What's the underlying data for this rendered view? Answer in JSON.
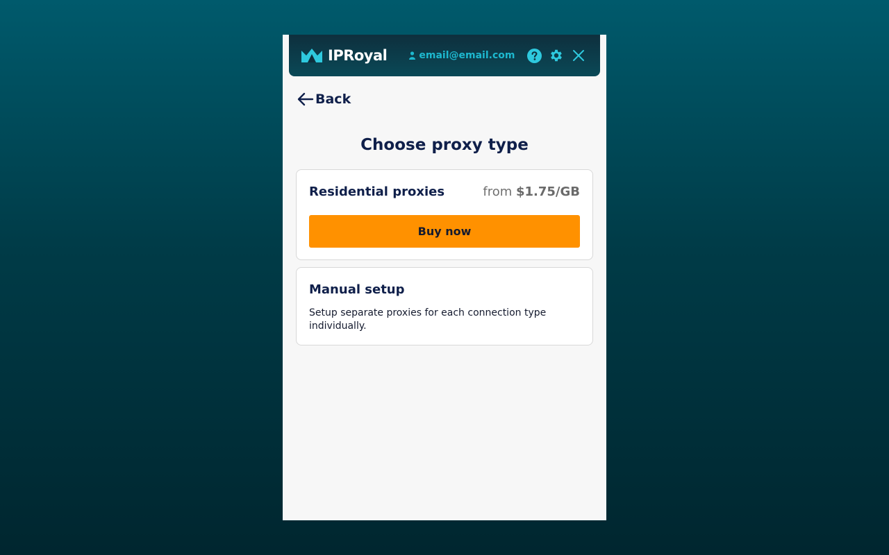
{
  "header": {
    "brand": "IPRoyal",
    "email": "email@email.com",
    "icons": [
      "user-icon",
      "help-icon",
      "gear-icon",
      "close-icon"
    ]
  },
  "nav": {
    "back_label": "Back"
  },
  "main": {
    "title": "Choose proxy type",
    "residential": {
      "title": "Residential proxies",
      "price_prefix": "from ",
      "price_value": "$1.75/GB",
      "button_label": "Buy now"
    },
    "manual": {
      "title": "Manual setup",
      "description": "Setup separate proxies for each connection type individually."
    }
  },
  "colors": {
    "accent_orange": "#ff9100",
    "navy_text": "#0f1f4a",
    "cyan": "#1db8cf",
    "header_bg": "#0e2f3d"
  }
}
